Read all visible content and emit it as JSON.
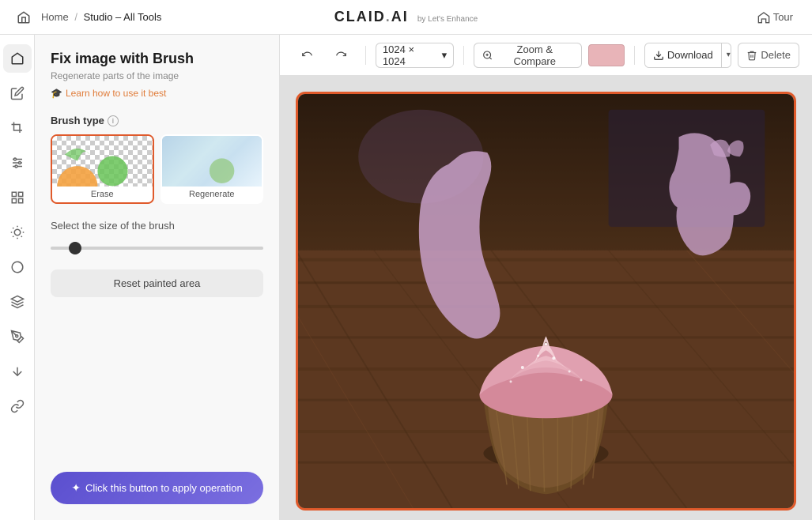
{
  "app": {
    "name": "CLAID.AI",
    "name_sub": "by Let's Enhance",
    "breadcrumb": {
      "home": "Home",
      "separator": "/",
      "current": "Studio – All Tools"
    },
    "tour_button": "Tour"
  },
  "icon_sidebar": {
    "items": [
      {
        "id": "home",
        "icon": "⌂",
        "label": "home-icon"
      },
      {
        "id": "edit",
        "icon": "✏",
        "label": "edit-icon"
      },
      {
        "id": "crop",
        "icon": "⊡",
        "label": "crop-icon"
      },
      {
        "id": "sliders",
        "icon": "≡",
        "label": "sliders-icon"
      },
      {
        "id": "grid",
        "icon": "⊞",
        "label": "grid-icon"
      },
      {
        "id": "sun",
        "icon": "☀",
        "label": "sun-icon"
      },
      {
        "id": "circle",
        "icon": "◎",
        "label": "circle-icon"
      },
      {
        "id": "layers",
        "icon": "⊕",
        "label": "layers-icon"
      },
      {
        "id": "pen",
        "icon": "🖊",
        "label": "pen-icon"
      },
      {
        "id": "adjust",
        "icon": "⇅",
        "label": "adjust-icon"
      },
      {
        "id": "link",
        "icon": "🔗",
        "label": "link-icon"
      }
    ]
  },
  "tools_panel": {
    "title": "Fix image with Brush",
    "subtitle": "Regenerate parts of the image",
    "learn_link": "Learn how to use it best",
    "brush_type_section": "Brush type",
    "brush_types": [
      {
        "id": "erase",
        "label": "Erase",
        "selected": true
      },
      {
        "id": "regenerate",
        "label": "Regenerate",
        "selected": false
      }
    ],
    "brush_size_label": "Select the size of the brush",
    "slider_value": 10,
    "reset_btn_label": "Reset painted area",
    "apply_btn_label": "Click this button to apply operation"
  },
  "canvas_toolbar": {
    "undo_title": "Undo",
    "redo_title": "Redo",
    "dimension": "1024 × 1024",
    "zoom_compare": "Zoom & Compare",
    "color_swatch": "#e8b4b8",
    "download_label": "Download",
    "delete_label": "Delete"
  }
}
